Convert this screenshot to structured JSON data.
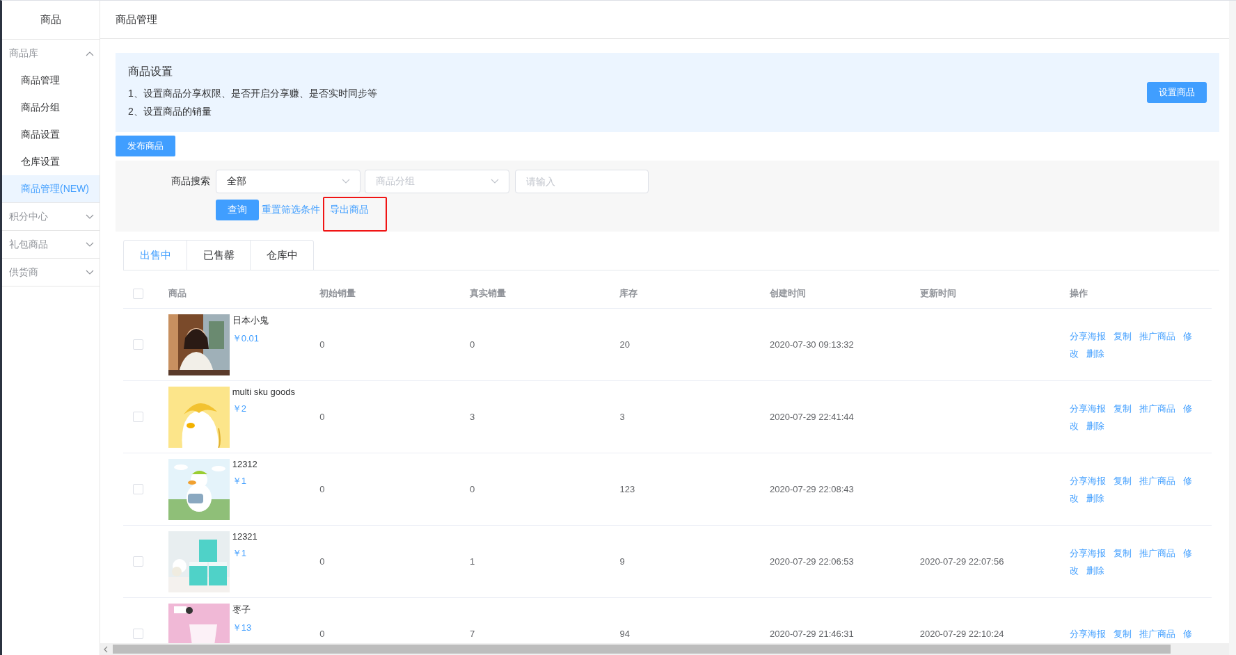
{
  "sidebar": {
    "title": "商品",
    "groups": [
      {
        "label": "商品库",
        "expanded": true,
        "items": [
          {
            "label": "商品管理",
            "selected": false
          },
          {
            "label": "商品分组",
            "selected": false
          },
          {
            "label": "商品设置",
            "selected": false
          },
          {
            "label": "仓库设置",
            "selected": false
          },
          {
            "label": "商品管理(NEW)",
            "selected": true
          }
        ]
      },
      {
        "label": "积分中心",
        "expanded": false
      },
      {
        "label": "礼包商品",
        "expanded": false
      },
      {
        "label": "供货商",
        "expanded": false
      }
    ]
  },
  "page_title": "商品管理",
  "notice": {
    "title": "商品设置",
    "lines": [
      "1、设置商品分享权限、是否开启分享赚、是否实时同步等",
      "2、设置商品的销量"
    ],
    "button": "设置商品"
  },
  "publish_button": "发布商品",
  "filter": {
    "label": "商品搜索",
    "scope_select": {
      "value": "全部"
    },
    "group_select": {
      "placeholder": "商品分组"
    },
    "keyword": {
      "placeholder": "请输入"
    },
    "query_button": "查询",
    "reset_link": "重置筛选条件",
    "export_link": {
      "label": "导出商品",
      "highlighted": true
    }
  },
  "tabs": [
    {
      "label": "出售中",
      "selected": true
    },
    {
      "label": "已售罄",
      "selected": false
    },
    {
      "label": "仓库中",
      "selected": false
    }
  ],
  "table": {
    "select_all_checked": false,
    "columns": [
      "商品",
      "初始销量",
      "真实销量",
      "库存",
      "创建时间",
      "更新时间",
      "操作"
    ],
    "rows": [
      {
        "checked": false,
        "name": "日本小鬼",
        "price": "￥0.01",
        "initial_sales": "0",
        "real_sales": "0",
        "stock": "20",
        "created": "2020-07-30 09:13:32",
        "actions": [
          "分享海报",
          "复制",
          "推广商品",
          "修",
          "改",
          "删除"
        ]
      },
      {
        "checked": false,
        "name": "multi sku goods",
        "price": "￥2",
        "initial_sales": "0",
        "real_sales": "3",
        "stock": "3",
        "created": "2020-07-29 22:41:44",
        "actions": [
          "分享海报",
          "复制",
          "推广商品",
          "修",
          "改",
          "删除"
        ]
      },
      {
        "checked": false,
        "name": "12312",
        "price": "￥1",
        "initial_sales": "0",
        "real_sales": "0",
        "stock": "123",
        "created": "2020-07-29 22:08:43",
        "actions": [
          "分享海报",
          "复制",
          "推广商品",
          "修",
          "改",
          "删除"
        ]
      },
      {
        "checked": false,
        "name": "12321",
        "price": "￥1",
        "initial_sales": "0",
        "real_sales": "1",
        "stock": "9",
        "created": "2020-07-29 22:06:53",
        "updated": "2020-07-29 22:07:56",
        "actions": [
          "分享海报",
          "复制",
          "推广商品",
          "修",
          "改",
          "删除"
        ]
      },
      {
        "checked": false,
        "name": "枣子",
        "price": "￥13",
        "initial_sales": "0",
        "real_sales": "7",
        "stock": "94",
        "created": "2020-07-29 21:46:31",
        "updated": "2020-07-29 22:10:24",
        "actions": [
          "分享海报",
          "复制",
          "推广商品",
          "修"
        ]
      }
    ]
  }
}
